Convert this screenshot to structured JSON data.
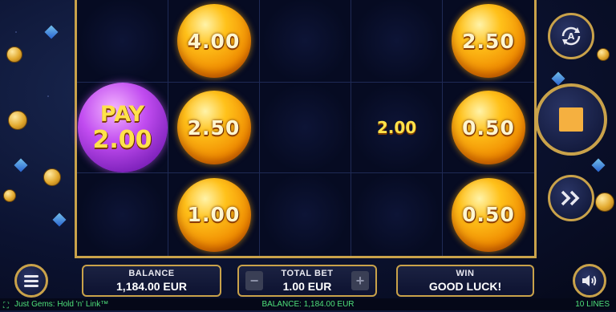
{
  "grid": [
    [
      {
        "kind": "empty"
      },
      {
        "kind": "orb",
        "value": "4.00"
      },
      {
        "kind": "empty"
      },
      {
        "kind": "empty"
      },
      {
        "kind": "orb",
        "value": "2.50"
      }
    ],
    [
      {
        "kind": "pay",
        "label": "PAY",
        "value": "2.00"
      },
      {
        "kind": "orb",
        "value": "2.50"
      },
      {
        "kind": "empty"
      },
      {
        "kind": "plain",
        "value": "2.00"
      },
      {
        "kind": "orb",
        "value": "0.50"
      }
    ],
    [
      {
        "kind": "empty"
      },
      {
        "kind": "orb",
        "value": "1.00"
      },
      {
        "kind": "empty"
      },
      {
        "kind": "empty"
      },
      {
        "kind": "orb",
        "value": "0.50"
      }
    ]
  ],
  "panels": {
    "balance": {
      "label": "BALANCE",
      "value": "1,184.00 EUR"
    },
    "total_bet": {
      "label": "TOTAL BET",
      "value": "1.00 EUR",
      "minus": "−",
      "plus": "+"
    },
    "win": {
      "label": "WIN",
      "value": "GOOD LUCK!"
    }
  },
  "footer": {
    "game_title": "Just Gems: Hold 'n' Link™",
    "balance": "BALANCE: 1,184.00 EUR",
    "lines": "10 LINES"
  },
  "icons": {
    "menu": "menu-icon",
    "sound": "speaker-icon",
    "autoplay": "autoplay-icon",
    "stop": "stop-icon",
    "turbo": "fast-forward-icon",
    "fullscreen": "fullscreen-icon"
  },
  "colors": {
    "gold_frame": "#c9a24a",
    "orb_gold": "#ffc11a",
    "pay_purple": "#c14cf0",
    "footer_green": "#4ee07a"
  }
}
